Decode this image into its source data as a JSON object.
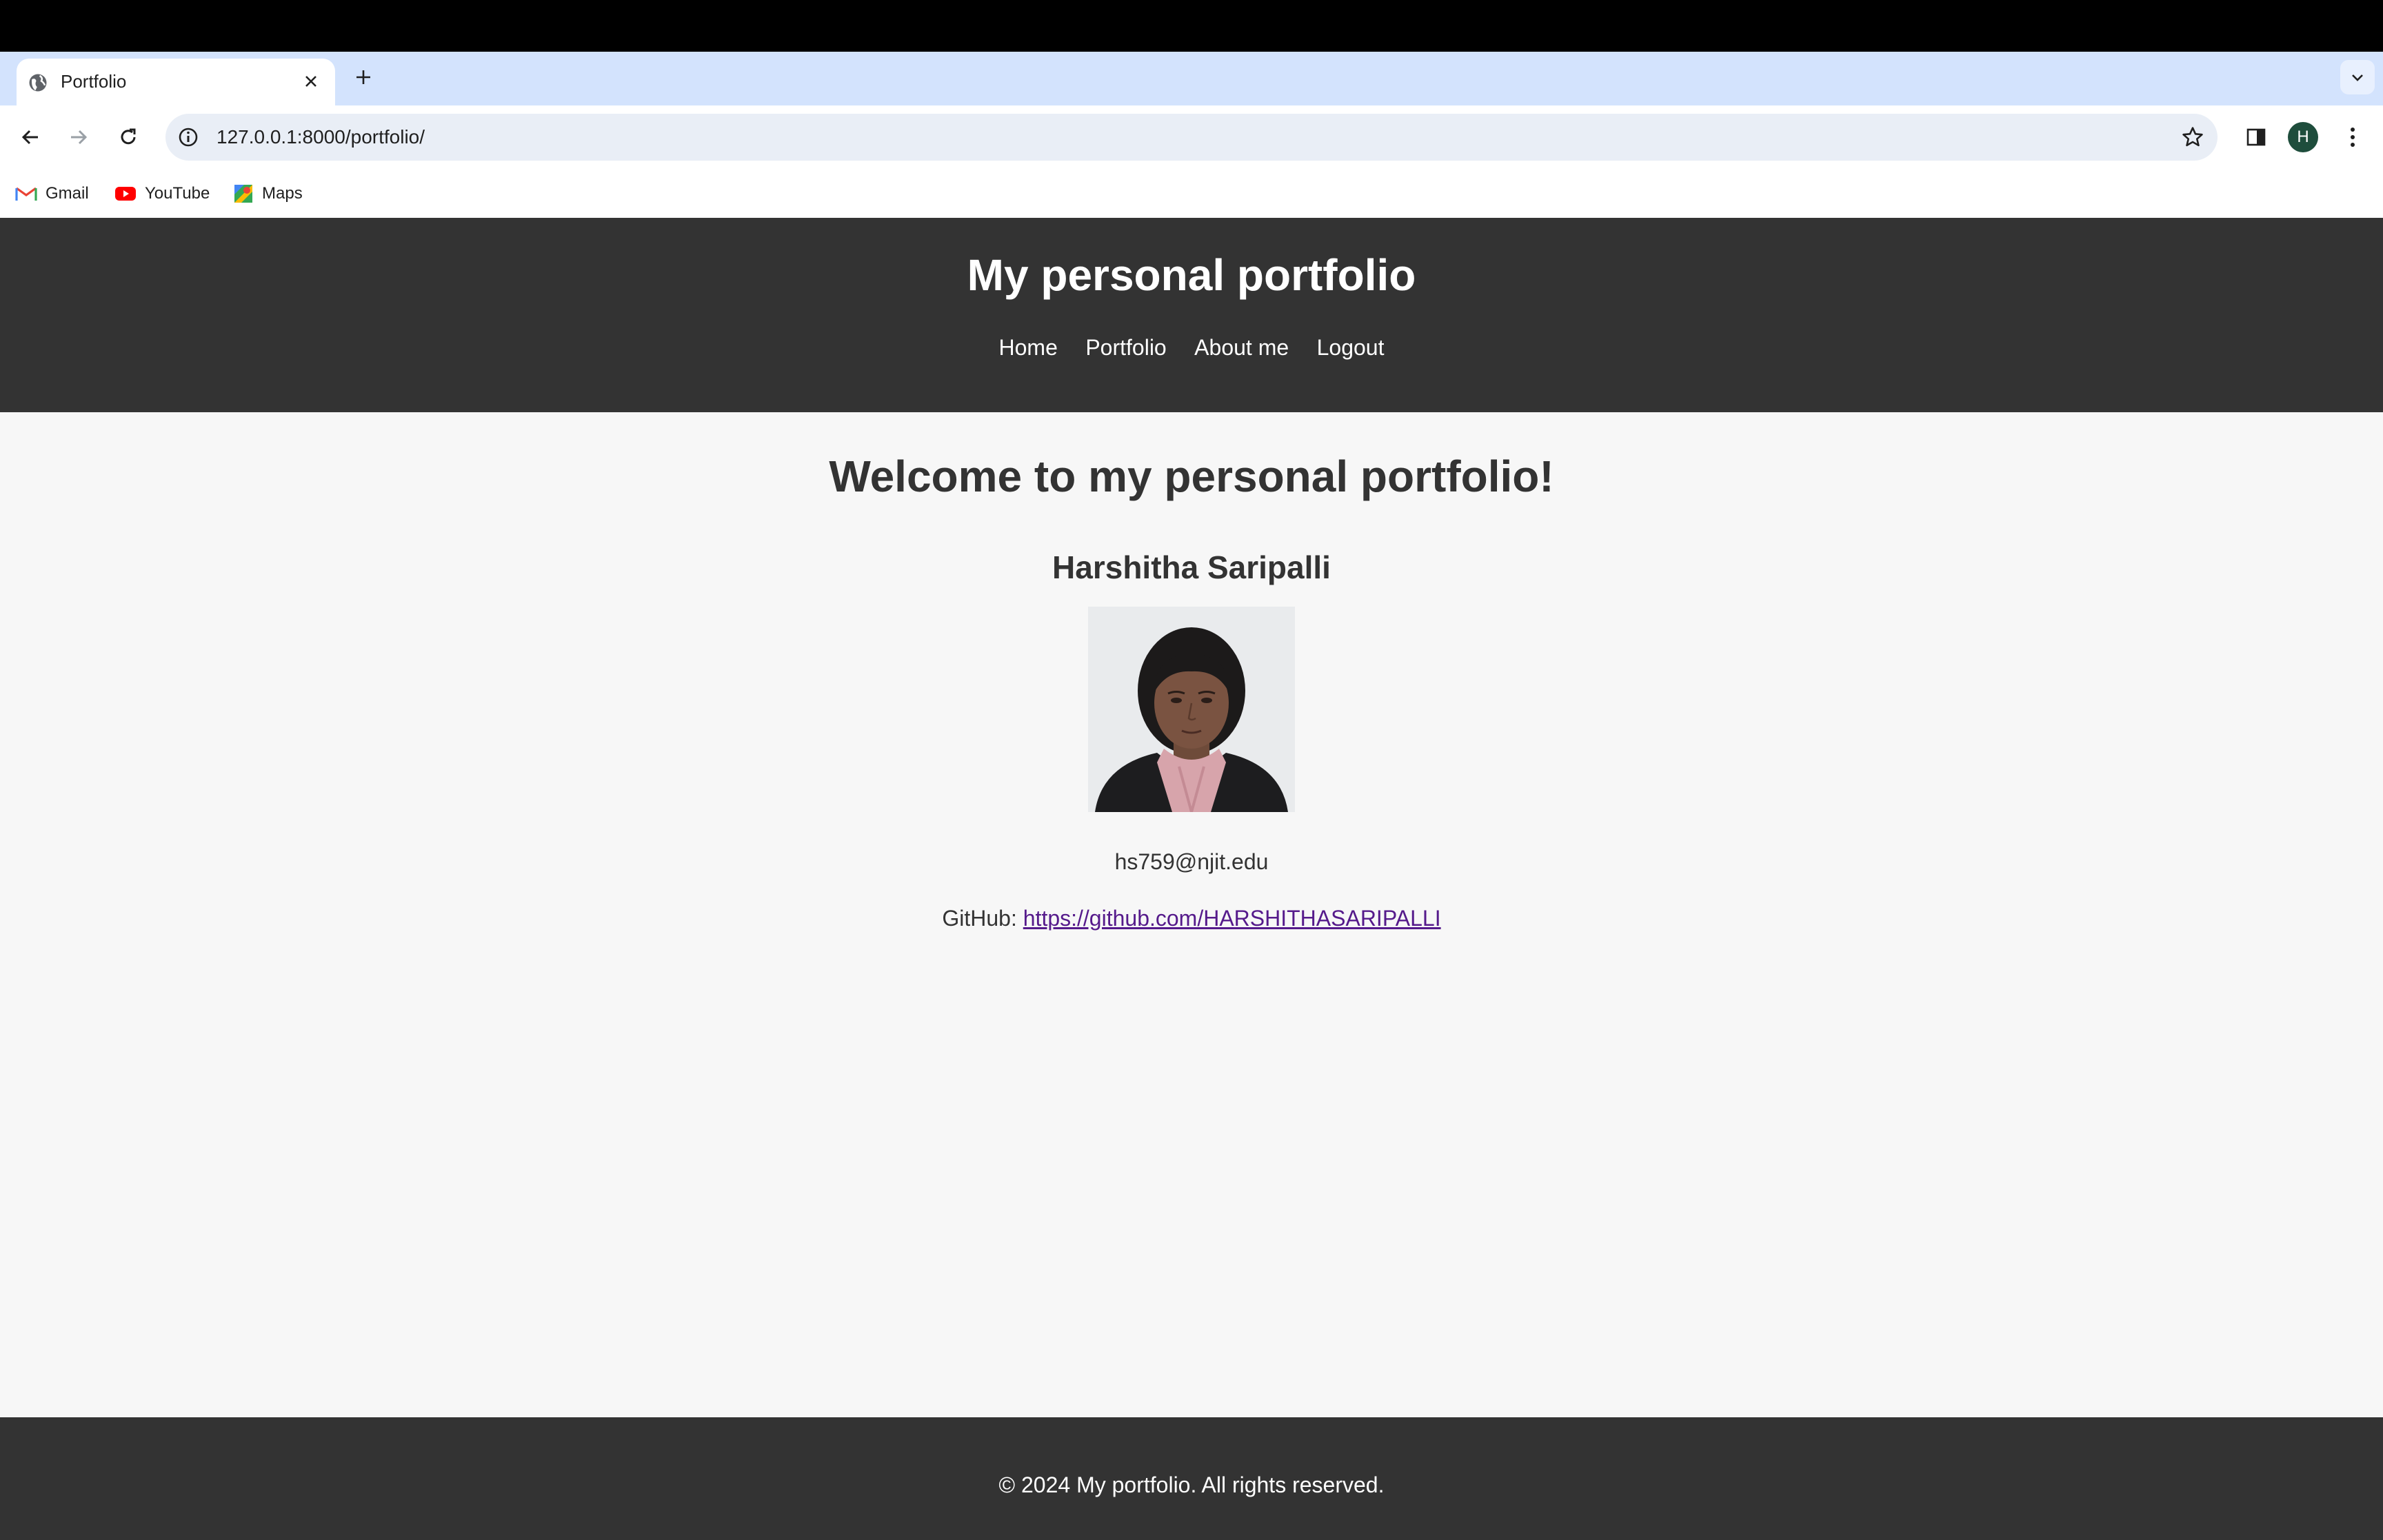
{
  "browser": {
    "tab_title": "Portfolio",
    "url": "127.0.0.1:8000/portfolio/",
    "profile_initial": "H",
    "bookmarks": [
      {
        "label": "Gmail",
        "icon": "gmail-icon"
      },
      {
        "label": "YouTube",
        "icon": "youtube-icon"
      },
      {
        "label": "Maps",
        "icon": "maps-icon"
      }
    ]
  },
  "site": {
    "title": "My personal portfolio",
    "nav": [
      "Home",
      "Portfolio",
      "About me",
      "Logout"
    ],
    "welcome": "Welcome to my personal portfolio!",
    "name": "Harshitha Saripalli",
    "email": "hs759@njit.edu",
    "github_label": "GitHub:",
    "github_url": "https://github.com/HARSHITHASARIPALLI",
    "footer": "© 2024 My portfolio. All rights reserved."
  },
  "colors": {
    "header_bg": "#333333",
    "page_bg": "#f7f7f7",
    "tabstrip_bg": "#d3e3fd",
    "link_visited": "#551a8b"
  }
}
